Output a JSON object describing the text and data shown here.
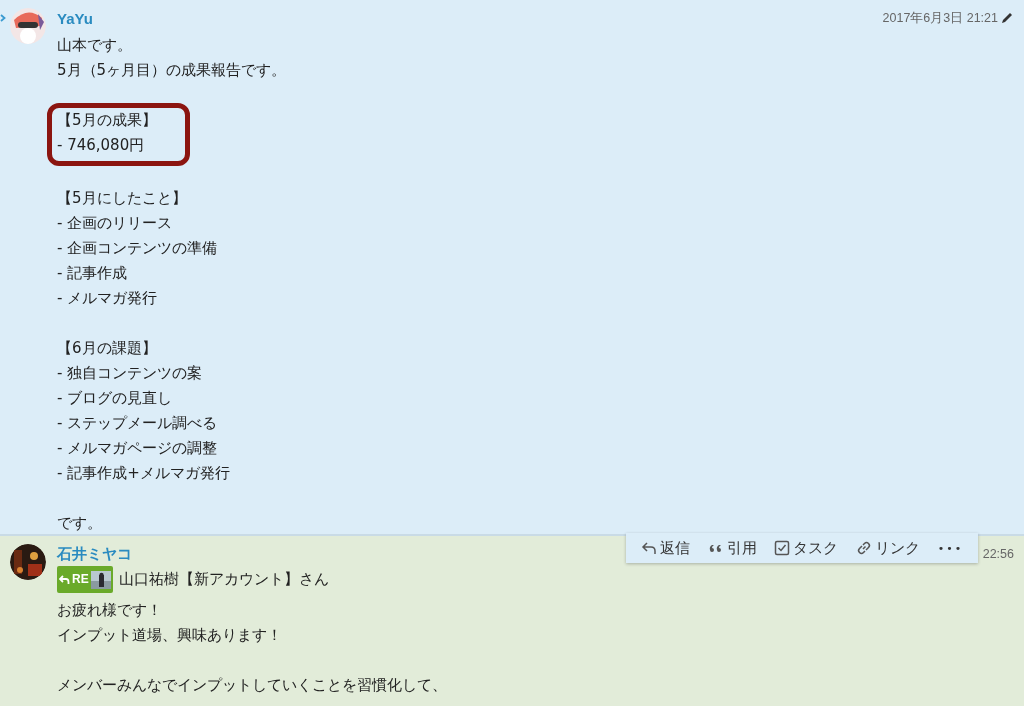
{
  "messages": [
    {
      "kind": "focused",
      "author": "YaYu",
      "timestamp": "2017年6月3日 21:21",
      "editable": true,
      "paragraphs": [
        {
          "highlighted": false,
          "lines": [
            "山本です。",
            "5月（5ヶ月目）の成果報告です。"
          ]
        },
        {
          "highlighted": true,
          "lines": [
            "【5月の成果】",
            "- 746,080円"
          ]
        },
        {
          "highlighted": false,
          "lines": [
            "【5月にしたこと】",
            "- 企画のリリース",
            "- 企画コンテンツの準備",
            "- 記事作成",
            "- メルマガ発行"
          ]
        },
        {
          "highlighted": false,
          "lines": [
            "【6月の課題】",
            "- 独自コンテンツの案",
            "- ブログの見直し",
            "- ステップメール調べる",
            "- メルマガページの調整",
            "- 記事作成+メルマガ発行"
          ]
        },
        {
          "highlighted": false,
          "lines": [
            "です。"
          ]
        }
      ]
    },
    {
      "kind": "to_me",
      "author": "石井ミヤコ",
      "timestamp": "22:56",
      "editable": false,
      "reply_to": {
        "label": "RE",
        "name": "山口祐樹【新アカウント】さん"
      },
      "paragraphs": [
        {
          "highlighted": false,
          "lines": [
            "お疲れ様です！",
            "インプット道場、興味あります！"
          ]
        },
        {
          "highlighted": false,
          "lines": [
            "メンバーみんなでインプットしていくことを習慣化して、"
          ]
        }
      ]
    }
  ],
  "actions": [
    {
      "kind": "reply",
      "label": "返信"
    },
    {
      "kind": "quote",
      "label": "引用"
    },
    {
      "kind": "task",
      "label": "タスク"
    },
    {
      "kind": "link",
      "label": "リンク"
    },
    {
      "kind": "more",
      "label": "•••"
    }
  ]
}
